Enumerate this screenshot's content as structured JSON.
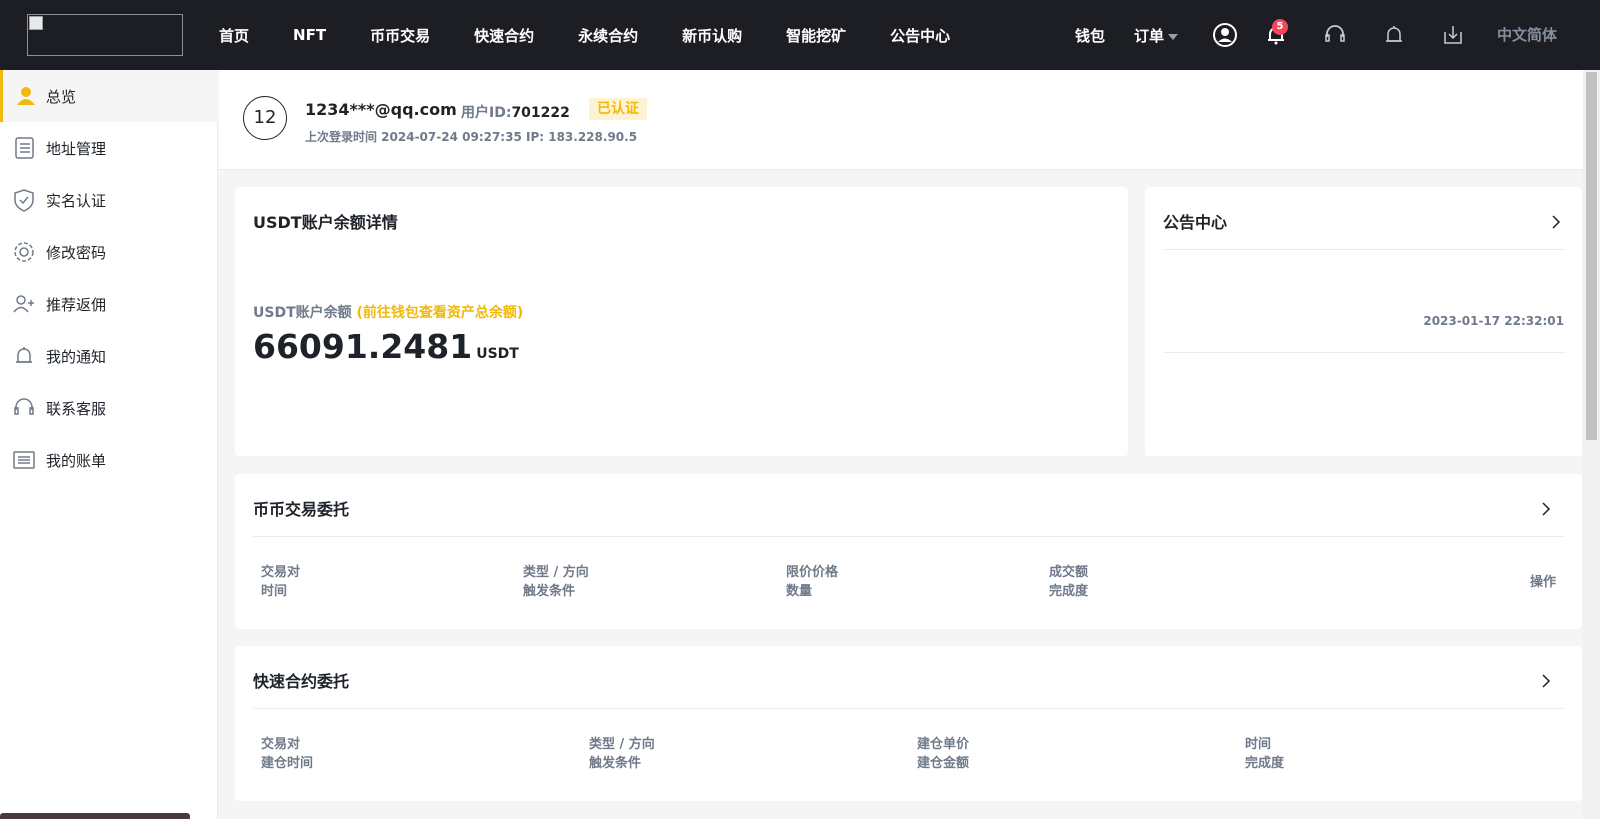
{
  "topbar": {
    "nav": [
      "首页",
      "NFT",
      "币币交易",
      "快速合约",
      "永续合约",
      "新币认购",
      "智能挖矿",
      "公告中心"
    ],
    "wallet": "钱包",
    "orders": "订单",
    "notification_count": "5",
    "language": "中文简体",
    "icons": [
      "user-circle-icon",
      "bell-icon",
      "headset-icon",
      "bell-outline-icon",
      "download-icon"
    ]
  },
  "sidebar": {
    "items": [
      {
        "label": "总览",
        "icon": "user-icon"
      },
      {
        "label": "地址管理",
        "icon": "list-icon"
      },
      {
        "label": "实名认证",
        "icon": "shield-icon"
      },
      {
        "label": "修改密码",
        "icon": "gear-icon"
      },
      {
        "label": "推荐返佣",
        "icon": "add-user-icon"
      },
      {
        "label": "我的通知",
        "icon": "bell-icon"
      },
      {
        "label": "联系客服",
        "icon": "headset-icon"
      },
      {
        "label": "我的账单",
        "icon": "bill-icon"
      }
    ],
    "active": 0
  },
  "user": {
    "avatar": "12",
    "email": "1234***@qq.com",
    "uid_label": "用户ID:",
    "uid": "701222",
    "verified": "已认证",
    "last_login": "上次登录时间 2024-07-24 09:27:35   IP: 183.228.90.5"
  },
  "balance_card": {
    "title": "USDT账户余额详情",
    "label": "USDT账户余额",
    "link": "(前往钱包查看资产总余额)",
    "value": "66091.2481",
    "unit": "USDT"
  },
  "announcement_card": {
    "title": "公告中心",
    "date": "2023-01-17 22:32:01"
  },
  "spot_orders": {
    "title": "币币交易委托",
    "columns": [
      [
        "交易对",
        "时间"
      ],
      [
        "类型 / 方向",
        "触发条件"
      ],
      [
        "限价价格",
        "数量"
      ],
      [
        "成交额",
        "完成度"
      ]
    ],
    "action": "操作"
  },
  "quick_contract": {
    "title": "快速合约委托",
    "columns": [
      [
        "交易对",
        "建仓时间"
      ],
      [
        "类型 / 方向",
        "触发条件"
      ],
      [
        "建仓单价",
        "建仓金额"
      ],
      [
        "时间",
        "完成度"
      ]
    ]
  },
  "colors": {
    "accent": "#f0b90b",
    "topbar": "#1c1e23",
    "badge": "#f6465d"
  }
}
